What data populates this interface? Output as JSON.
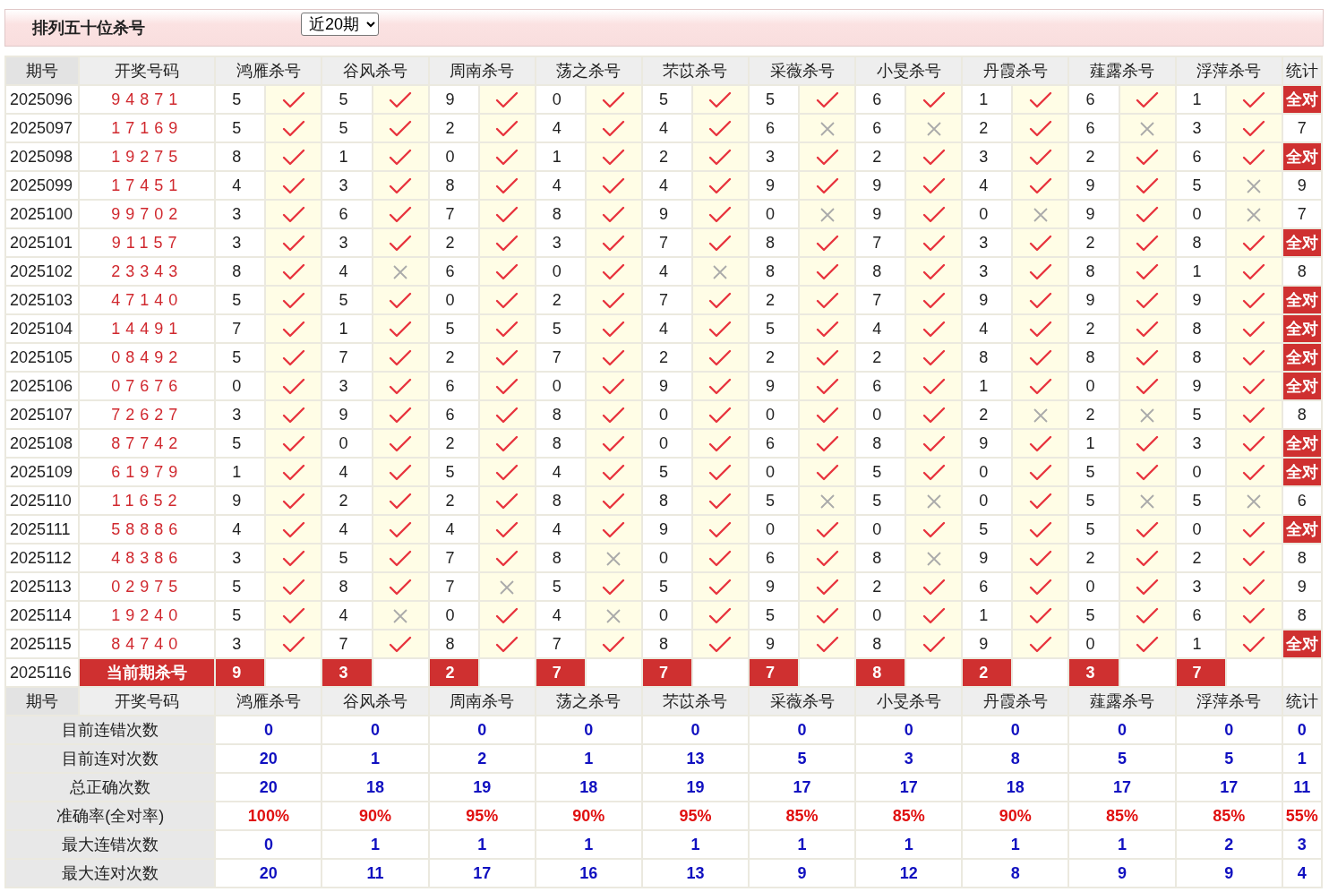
{
  "header": {
    "title": "排列五十位杀号",
    "range_select": {
      "value": "近20期"
    }
  },
  "columns": {
    "period": "期号",
    "draw": "开奖号码",
    "predictors": [
      "鸿雁杀号",
      "谷风杀号",
      "周南杀号",
      "荡之杀号",
      "芣苡杀号",
      "采薇杀号",
      "小旻杀号",
      "丹霞杀号",
      "薤露杀号",
      "浮萍杀号"
    ],
    "stat": "统计"
  },
  "rows": [
    {
      "period": "2025096",
      "draw": "94871",
      "picks": [
        {
          "n": "5",
          "ok": true
        },
        {
          "n": "5",
          "ok": true
        },
        {
          "n": "9",
          "ok": true
        },
        {
          "n": "0",
          "ok": true
        },
        {
          "n": "5",
          "ok": true
        },
        {
          "n": "5",
          "ok": true
        },
        {
          "n": "6",
          "ok": true
        },
        {
          "n": "1",
          "ok": true
        },
        {
          "n": "6",
          "ok": true
        },
        {
          "n": "1",
          "ok": true
        }
      ],
      "stat": {
        "kind": "badge",
        "text": "全对"
      }
    },
    {
      "period": "2025097",
      "draw": "17169",
      "picks": [
        {
          "n": "5",
          "ok": true
        },
        {
          "n": "5",
          "ok": true
        },
        {
          "n": "2",
          "ok": true
        },
        {
          "n": "4",
          "ok": true
        },
        {
          "n": "4",
          "ok": true
        },
        {
          "n": "6",
          "ok": false
        },
        {
          "n": "6",
          "ok": false
        },
        {
          "n": "2",
          "ok": true
        },
        {
          "n": "6",
          "ok": false
        },
        {
          "n": "3",
          "ok": true
        }
      ],
      "stat": {
        "kind": "plain",
        "text": "7"
      }
    },
    {
      "period": "2025098",
      "draw": "19275",
      "picks": [
        {
          "n": "8",
          "ok": true
        },
        {
          "n": "1",
          "ok": true
        },
        {
          "n": "0",
          "ok": true
        },
        {
          "n": "1",
          "ok": true
        },
        {
          "n": "2",
          "ok": true
        },
        {
          "n": "3",
          "ok": true
        },
        {
          "n": "2",
          "ok": true
        },
        {
          "n": "3",
          "ok": true
        },
        {
          "n": "2",
          "ok": true
        },
        {
          "n": "6",
          "ok": true
        }
      ],
      "stat": {
        "kind": "badge",
        "text": "全对"
      }
    },
    {
      "period": "2025099",
      "draw": "17451",
      "picks": [
        {
          "n": "4",
          "ok": true
        },
        {
          "n": "3",
          "ok": true
        },
        {
          "n": "8",
          "ok": true
        },
        {
          "n": "4",
          "ok": true
        },
        {
          "n": "4",
          "ok": true
        },
        {
          "n": "9",
          "ok": true
        },
        {
          "n": "9",
          "ok": true
        },
        {
          "n": "4",
          "ok": true
        },
        {
          "n": "9",
          "ok": true
        },
        {
          "n": "5",
          "ok": false
        }
      ],
      "stat": {
        "kind": "plain",
        "text": "9"
      }
    },
    {
      "period": "2025100",
      "draw": "99702",
      "picks": [
        {
          "n": "3",
          "ok": true
        },
        {
          "n": "6",
          "ok": true
        },
        {
          "n": "7",
          "ok": true
        },
        {
          "n": "8",
          "ok": true
        },
        {
          "n": "9",
          "ok": true
        },
        {
          "n": "0",
          "ok": false
        },
        {
          "n": "9",
          "ok": true
        },
        {
          "n": "0",
          "ok": false
        },
        {
          "n": "9",
          "ok": true
        },
        {
          "n": "0",
          "ok": false
        }
      ],
      "stat": {
        "kind": "plain",
        "text": "7"
      }
    },
    {
      "period": "2025101",
      "draw": "91157",
      "picks": [
        {
          "n": "3",
          "ok": true
        },
        {
          "n": "3",
          "ok": true
        },
        {
          "n": "2",
          "ok": true
        },
        {
          "n": "3",
          "ok": true
        },
        {
          "n": "7",
          "ok": true
        },
        {
          "n": "8",
          "ok": true
        },
        {
          "n": "7",
          "ok": true
        },
        {
          "n": "3",
          "ok": true
        },
        {
          "n": "2",
          "ok": true
        },
        {
          "n": "8",
          "ok": true
        }
      ],
      "stat": {
        "kind": "badge",
        "text": "全对"
      }
    },
    {
      "period": "2025102",
      "draw": "23343",
      "picks": [
        {
          "n": "8",
          "ok": true
        },
        {
          "n": "4",
          "ok": false
        },
        {
          "n": "6",
          "ok": true
        },
        {
          "n": "0",
          "ok": true
        },
        {
          "n": "4",
          "ok": false
        },
        {
          "n": "8",
          "ok": true
        },
        {
          "n": "8",
          "ok": true
        },
        {
          "n": "3",
          "ok": true
        },
        {
          "n": "8",
          "ok": true
        },
        {
          "n": "1",
          "ok": true
        }
      ],
      "stat": {
        "kind": "plain",
        "text": "8"
      }
    },
    {
      "period": "2025103",
      "draw": "47140",
      "picks": [
        {
          "n": "5",
          "ok": true
        },
        {
          "n": "5",
          "ok": true
        },
        {
          "n": "0",
          "ok": true
        },
        {
          "n": "2",
          "ok": true
        },
        {
          "n": "7",
          "ok": true
        },
        {
          "n": "2",
          "ok": true
        },
        {
          "n": "7",
          "ok": true
        },
        {
          "n": "9",
          "ok": true
        },
        {
          "n": "9",
          "ok": true
        },
        {
          "n": "9",
          "ok": true
        }
      ],
      "stat": {
        "kind": "badge",
        "text": "全对"
      }
    },
    {
      "period": "2025104",
      "draw": "14491",
      "picks": [
        {
          "n": "7",
          "ok": true
        },
        {
          "n": "1",
          "ok": true
        },
        {
          "n": "5",
          "ok": true
        },
        {
          "n": "5",
          "ok": true
        },
        {
          "n": "4",
          "ok": true
        },
        {
          "n": "5",
          "ok": true
        },
        {
          "n": "4",
          "ok": true
        },
        {
          "n": "4",
          "ok": true
        },
        {
          "n": "2",
          "ok": true
        },
        {
          "n": "8",
          "ok": true
        }
      ],
      "stat": {
        "kind": "badge",
        "text": "全对"
      }
    },
    {
      "period": "2025105",
      "draw": "08492",
      "picks": [
        {
          "n": "5",
          "ok": true
        },
        {
          "n": "7",
          "ok": true
        },
        {
          "n": "2",
          "ok": true
        },
        {
          "n": "7",
          "ok": true
        },
        {
          "n": "2",
          "ok": true
        },
        {
          "n": "2",
          "ok": true
        },
        {
          "n": "2",
          "ok": true
        },
        {
          "n": "8",
          "ok": true
        },
        {
          "n": "8",
          "ok": true
        },
        {
          "n": "8",
          "ok": true
        }
      ],
      "stat": {
        "kind": "badge",
        "text": "全对"
      }
    },
    {
      "period": "2025106",
      "draw": "07676",
      "picks": [
        {
          "n": "0",
          "ok": true
        },
        {
          "n": "3",
          "ok": true
        },
        {
          "n": "6",
          "ok": true
        },
        {
          "n": "0",
          "ok": true
        },
        {
          "n": "9",
          "ok": true
        },
        {
          "n": "9",
          "ok": true
        },
        {
          "n": "6",
          "ok": true
        },
        {
          "n": "1",
          "ok": true
        },
        {
          "n": "0",
          "ok": true
        },
        {
          "n": "9",
          "ok": true
        }
      ],
      "stat": {
        "kind": "badge",
        "text": "全对"
      }
    },
    {
      "period": "2025107",
      "draw": "72627",
      "picks": [
        {
          "n": "3",
          "ok": true
        },
        {
          "n": "9",
          "ok": true
        },
        {
          "n": "6",
          "ok": true
        },
        {
          "n": "8",
          "ok": true
        },
        {
          "n": "0",
          "ok": true
        },
        {
          "n": "0",
          "ok": true
        },
        {
          "n": "0",
          "ok": true
        },
        {
          "n": "2",
          "ok": false
        },
        {
          "n": "2",
          "ok": false
        },
        {
          "n": "5",
          "ok": true
        }
      ],
      "stat": {
        "kind": "plain",
        "text": "8"
      }
    },
    {
      "period": "2025108",
      "draw": "87742",
      "picks": [
        {
          "n": "5",
          "ok": true
        },
        {
          "n": "0",
          "ok": true
        },
        {
          "n": "2",
          "ok": true
        },
        {
          "n": "8",
          "ok": true
        },
        {
          "n": "0",
          "ok": true
        },
        {
          "n": "6",
          "ok": true
        },
        {
          "n": "8",
          "ok": true
        },
        {
          "n": "9",
          "ok": true
        },
        {
          "n": "1",
          "ok": true
        },
        {
          "n": "3",
          "ok": true
        }
      ],
      "stat": {
        "kind": "badge",
        "text": "全对"
      }
    },
    {
      "period": "2025109",
      "draw": "61979",
      "picks": [
        {
          "n": "1",
          "ok": true
        },
        {
          "n": "4",
          "ok": true
        },
        {
          "n": "5",
          "ok": true
        },
        {
          "n": "4",
          "ok": true
        },
        {
          "n": "5",
          "ok": true
        },
        {
          "n": "0",
          "ok": true
        },
        {
          "n": "5",
          "ok": true
        },
        {
          "n": "0",
          "ok": true
        },
        {
          "n": "5",
          "ok": true
        },
        {
          "n": "0",
          "ok": true
        }
      ],
      "stat": {
        "kind": "badge",
        "text": "全对"
      }
    },
    {
      "period": "2025110",
      "draw": "11652",
      "picks": [
        {
          "n": "9",
          "ok": true
        },
        {
          "n": "2",
          "ok": true
        },
        {
          "n": "2",
          "ok": true
        },
        {
          "n": "8",
          "ok": true
        },
        {
          "n": "8",
          "ok": true
        },
        {
          "n": "5",
          "ok": false
        },
        {
          "n": "5",
          "ok": false
        },
        {
          "n": "0",
          "ok": true
        },
        {
          "n": "5",
          "ok": false
        },
        {
          "n": "5",
          "ok": false
        }
      ],
      "stat": {
        "kind": "plain",
        "text": "6"
      }
    },
    {
      "period": "2025111",
      "draw": "58886",
      "picks": [
        {
          "n": "4",
          "ok": true
        },
        {
          "n": "4",
          "ok": true
        },
        {
          "n": "4",
          "ok": true
        },
        {
          "n": "4",
          "ok": true
        },
        {
          "n": "9",
          "ok": true
        },
        {
          "n": "0",
          "ok": true
        },
        {
          "n": "0",
          "ok": true
        },
        {
          "n": "5",
          "ok": true
        },
        {
          "n": "5",
          "ok": true
        },
        {
          "n": "0",
          "ok": true
        }
      ],
      "stat": {
        "kind": "badge",
        "text": "全对"
      }
    },
    {
      "period": "2025112",
      "draw": "48386",
      "picks": [
        {
          "n": "3",
          "ok": true
        },
        {
          "n": "5",
          "ok": true
        },
        {
          "n": "7",
          "ok": true
        },
        {
          "n": "8",
          "ok": false
        },
        {
          "n": "0",
          "ok": true
        },
        {
          "n": "6",
          "ok": true
        },
        {
          "n": "8",
          "ok": false
        },
        {
          "n": "9",
          "ok": true
        },
        {
          "n": "2",
          "ok": true
        },
        {
          "n": "2",
          "ok": true
        }
      ],
      "stat": {
        "kind": "plain",
        "text": "8"
      }
    },
    {
      "period": "2025113",
      "draw": "02975",
      "picks": [
        {
          "n": "5",
          "ok": true
        },
        {
          "n": "8",
          "ok": true
        },
        {
          "n": "7",
          "ok": false
        },
        {
          "n": "5",
          "ok": true
        },
        {
          "n": "5",
          "ok": true
        },
        {
          "n": "9",
          "ok": true
        },
        {
          "n": "2",
          "ok": true
        },
        {
          "n": "6",
          "ok": true
        },
        {
          "n": "0",
          "ok": true
        },
        {
          "n": "3",
          "ok": true
        }
      ],
      "stat": {
        "kind": "plain",
        "text": "9"
      }
    },
    {
      "period": "2025114",
      "draw": "19240",
      "picks": [
        {
          "n": "5",
          "ok": true
        },
        {
          "n": "4",
          "ok": false
        },
        {
          "n": "0",
          "ok": true
        },
        {
          "n": "4",
          "ok": false
        },
        {
          "n": "0",
          "ok": true
        },
        {
          "n": "5",
          "ok": true
        },
        {
          "n": "0",
          "ok": true
        },
        {
          "n": "1",
          "ok": true
        },
        {
          "n": "5",
          "ok": true
        },
        {
          "n": "6",
          "ok": true
        }
      ],
      "stat": {
        "kind": "plain",
        "text": "8"
      }
    },
    {
      "period": "2025115",
      "draw": "84740",
      "picks": [
        {
          "n": "3",
          "ok": true
        },
        {
          "n": "7",
          "ok": true
        },
        {
          "n": "8",
          "ok": true
        },
        {
          "n": "7",
          "ok": true
        },
        {
          "n": "8",
          "ok": true
        },
        {
          "n": "9",
          "ok": true
        },
        {
          "n": "8",
          "ok": true
        },
        {
          "n": "9",
          "ok": true
        },
        {
          "n": "0",
          "ok": true
        },
        {
          "n": "1",
          "ok": true
        }
      ],
      "stat": {
        "kind": "badge",
        "text": "全对"
      }
    }
  ],
  "current": {
    "period": "2025116",
    "label": "当前期杀号",
    "picks": [
      "9",
      "3",
      "2",
      "7",
      "7",
      "7",
      "8",
      "2",
      "3",
      "7"
    ]
  },
  "footer_columns": {
    "period": "期号",
    "draw": "开奖号码",
    "predictors": [
      "鸿雁杀号",
      "谷风杀号",
      "周南杀号",
      "荡之杀号",
      "芣苡杀号",
      "采薇杀号",
      "小旻杀号",
      "丹霞杀号",
      "薤露杀号",
      "浮萍杀号"
    ],
    "stat": "统计"
  },
  "summary": [
    {
      "label": "目前连错次数",
      "kind": "count",
      "values": [
        "0",
        "0",
        "0",
        "0",
        "0",
        "0",
        "0",
        "0",
        "0",
        "0"
      ],
      "stat": "0"
    },
    {
      "label": "目前连对次数",
      "kind": "count",
      "values": [
        "20",
        "1",
        "2",
        "1",
        "13",
        "5",
        "3",
        "8",
        "5",
        "5"
      ],
      "stat": "1"
    },
    {
      "label": "总正确次数",
      "kind": "count",
      "values": [
        "20",
        "18",
        "19",
        "18",
        "19",
        "17",
        "17",
        "18",
        "17",
        "17"
      ],
      "stat": "11"
    },
    {
      "label": "准确率(全对率)",
      "kind": "rate",
      "values": [
        "100%",
        "90%",
        "95%",
        "90%",
        "95%",
        "85%",
        "85%",
        "90%",
        "85%",
        "85%"
      ],
      "stat": "55%"
    },
    {
      "label": "最大连错次数",
      "kind": "count",
      "values": [
        "0",
        "1",
        "1",
        "1",
        "1",
        "1",
        "1",
        "1",
        "1",
        "2"
      ],
      "stat": "3"
    },
    {
      "label": "最大连对次数",
      "kind": "count",
      "values": [
        "20",
        "11",
        "17",
        "16",
        "13",
        "9",
        "12",
        "8",
        "9",
        "9"
      ],
      "stat": "4"
    }
  ]
}
